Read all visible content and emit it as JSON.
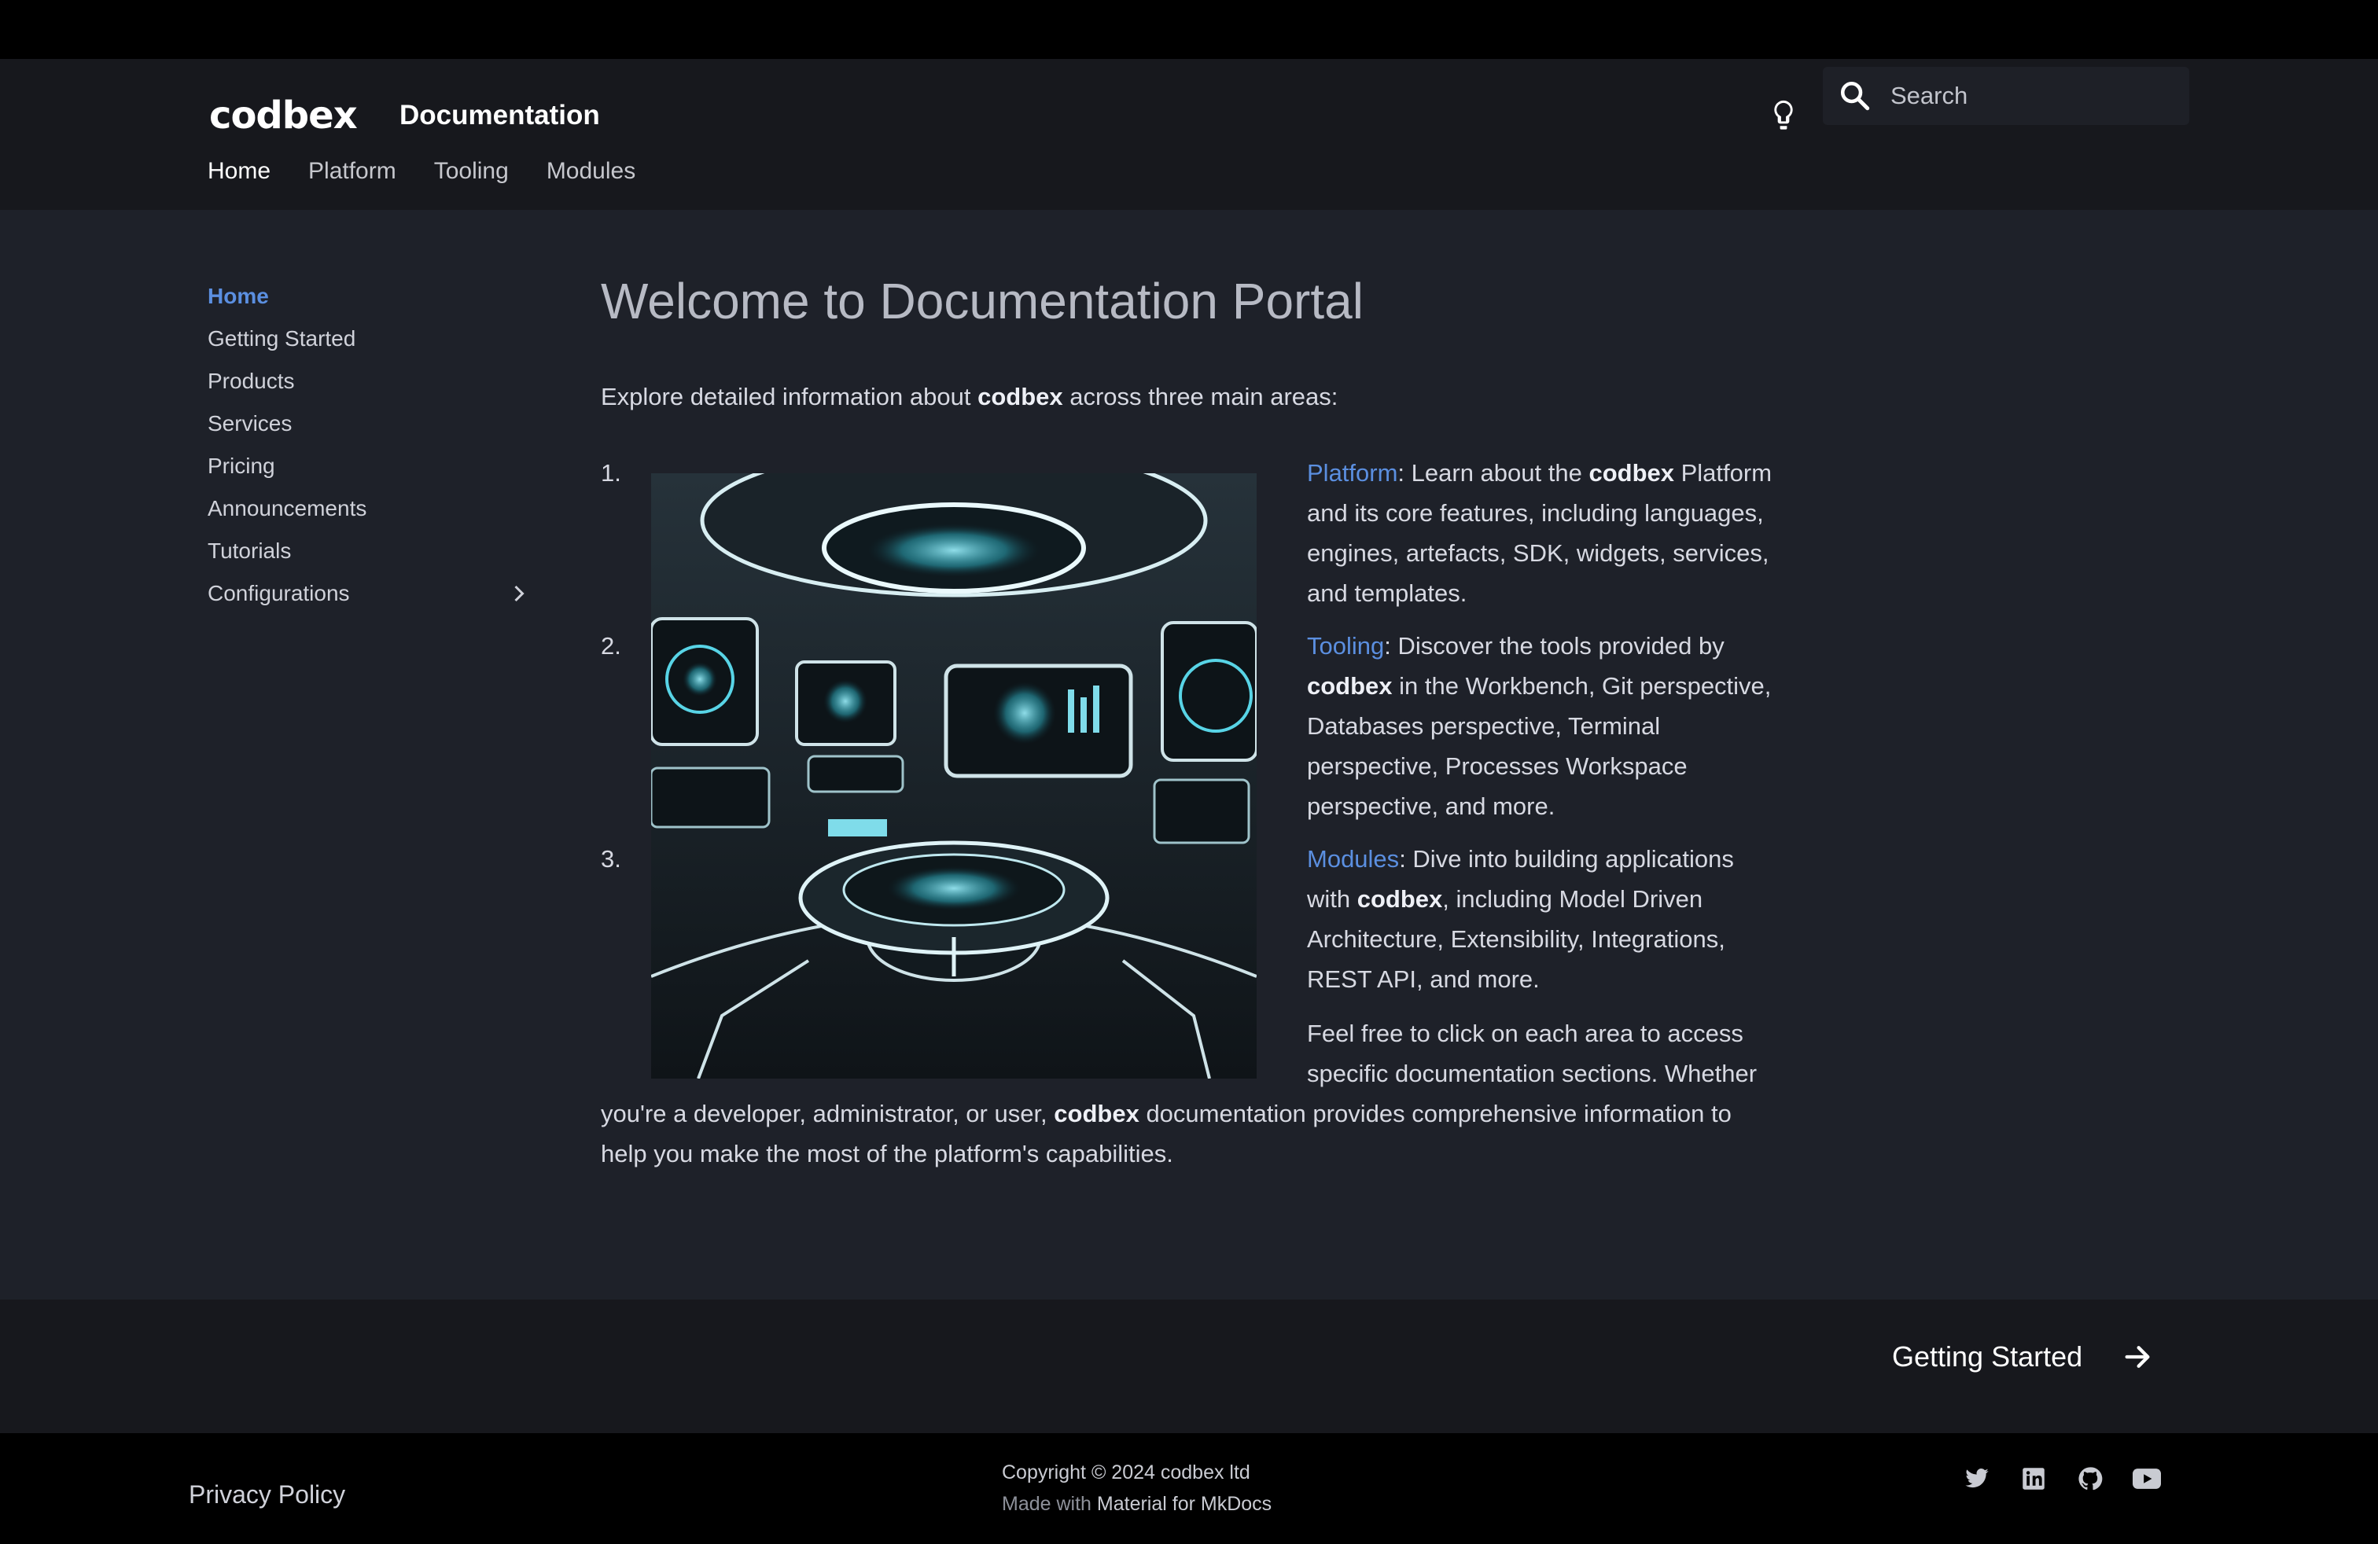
{
  "header": {
    "logo": "codbex",
    "site_title": "Documentation",
    "search_placeholder": "Search",
    "tabs": [
      "Home",
      "Platform",
      "Tooling",
      "Modules"
    ]
  },
  "sidebar": {
    "items": [
      {
        "label": "Home"
      },
      {
        "label": "Getting Started"
      },
      {
        "label": "Products"
      },
      {
        "label": "Services"
      },
      {
        "label": "Pricing"
      },
      {
        "label": "Announcements"
      },
      {
        "label": "Tutorials"
      },
      {
        "label": "Configurations"
      }
    ]
  },
  "main": {
    "title": "Welcome to Documentation Portal",
    "intro_pre": "Explore detailed information about ",
    "intro_bold": "codbex",
    "intro_post": " across three main areas:",
    "steps": [
      {
        "num": "1.",
        "link": "Platform",
        "t1": ": Learn about the ",
        "b1": "codbex",
        "t2": " Platform and its core features, including languages, engines, artefacts, SDK, widgets, services, and templates."
      },
      {
        "num": "2.",
        "link": "Tooling",
        "t1": ": Discover the tools provided by ",
        "b1": "codbex",
        "t2": " in the Workbench, Git perspective, Databases perspective, Terminal perspective, Processes Workspace perspective, and more."
      },
      {
        "num": "3.",
        "link": "Modules",
        "t1": ": Dive into building applications with ",
        "b1": "codbex",
        "t2": ", including Model Driven Architecture, Extensibility, Integrations, REST API, and more."
      }
    ],
    "outro_pre": "Feel free to click on each area to access specific documentation sections. Whether you're a developer, administrator, or user, ",
    "outro_bold": "codbex",
    "outro_post": " documentation provides comprehensive information to help you make the most of the platform's capabilities."
  },
  "footer": {
    "next_label": "Getting Started",
    "privacy": "Privacy Policy",
    "copyright": "Copyright © 2024 codbex ltd",
    "made_with": "Made with",
    "made_with_link": "Material for MkDocs",
    "social_icons": [
      "twitter-icon",
      "linkedin-icon",
      "github-icon",
      "youtube-icon"
    ]
  },
  "colors": {
    "accent": "#5b8fe0",
    "background": "#1e2129",
    "header": "#17181d"
  }
}
